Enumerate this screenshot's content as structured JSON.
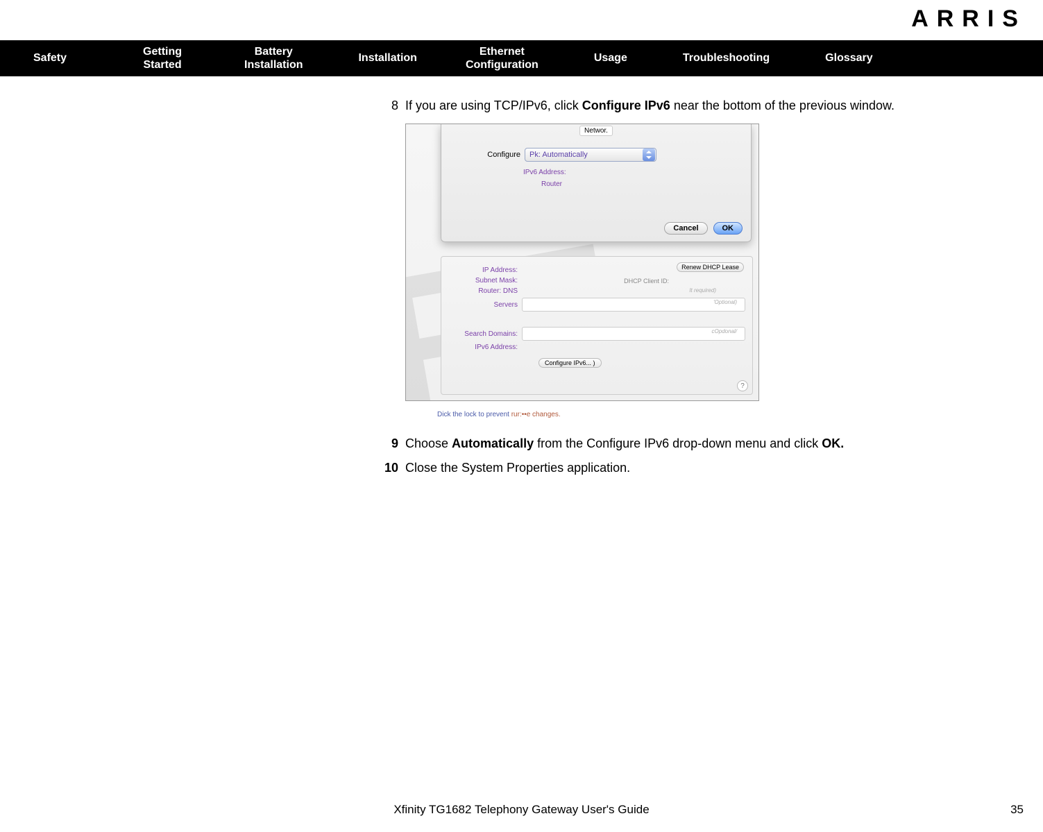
{
  "brand": "ARRIS",
  "nav": {
    "safety": "Safety",
    "getting_started_l1": "Getting",
    "getting_started_l2": "Started",
    "battery_l1": "Battery",
    "battery_l2": "Installation",
    "installation": "Installation",
    "ethernet_l1": "Ethernet",
    "ethernet_l2": "Configuration",
    "usage": "Usage",
    "troubleshooting": "Troubleshooting",
    "glossary": "Glossary"
  },
  "steps": {
    "s8_num": "8",
    "s8_a": "If you are using TCP/IPv6, click ",
    "s8_b": "Configure IPv6",
    "s8_c": " near the bottom of the previous window.",
    "s9_num": "9",
    "s9_a": "Choose ",
    "s9_b": "Automatically",
    "s9_c": " from the Configure IPv6 drop-down menu and click ",
    "s9_d": "OK.",
    "s10_num": "10",
    "s10_a": "Close the System Properties application."
  },
  "figure": {
    "sheet_title": "Networ.",
    "configure_label": "Configure",
    "configure_value": "Pk: Automatically",
    "ipv6_addr": "IPv6 Address:",
    "router": "Router",
    "cancel": "Cancel",
    "ok": "OK",
    "ip_address": "IP Address:",
    "subnet_mask": "Subnet Mask:",
    "router_dns": "Router: DNS",
    "servers": "Servers",
    "search_domains": "Search Domains:",
    "ipv6_address2": "IPv6 Address:",
    "renew": "Renew DHCP Lease",
    "dhcp_client": "DHCP Client ID:",
    "if_required": "It required)",
    "optional1": "'Optional)",
    "optional2": "cOpdonal/",
    "configure_ipv6": "Configure IPv6... )",
    "help": "?"
  },
  "lock_note_a": "Dick the lock to prevent ",
  "lock_note_b": "rur:••e changes.",
  "footer": {
    "title": "Xfinity TG1682 Telephony Gateway User's Guide",
    "page": "35"
  }
}
